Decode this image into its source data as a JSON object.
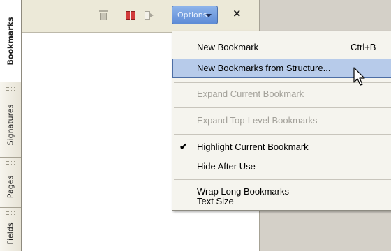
{
  "tabs": [
    {
      "label": "Bookmarks",
      "active": true
    },
    {
      "label": "Signatures",
      "active": false
    },
    {
      "label": "Pages",
      "active": false
    },
    {
      "label": "Fields",
      "active": false
    }
  ],
  "toolbar": {
    "delete_icon": "trash-icon",
    "new_bookmark_icon": "book-icon",
    "go_icon": "page-arrow-icon",
    "options_label": "Options",
    "close_label": "×"
  },
  "menu": {
    "new_bookmark": "New Bookmark",
    "new_bookmark_shortcut": "Ctrl+B",
    "new_from_structure": "New Bookmarks from Structure...",
    "expand_current": "Expand Current Bookmark",
    "expand_top_level": "Expand Top-Level Bookmarks",
    "highlight_current": "Highlight Current Bookmark",
    "highlight_checked": true,
    "hide_after_use": "Hide After Use",
    "wrap_long": "Wrap Long Bookmarks",
    "text_size": "Text Size"
  },
  "colors": {
    "menu_highlight": "#b7cbea",
    "options_button": "#6f9be0"
  }
}
